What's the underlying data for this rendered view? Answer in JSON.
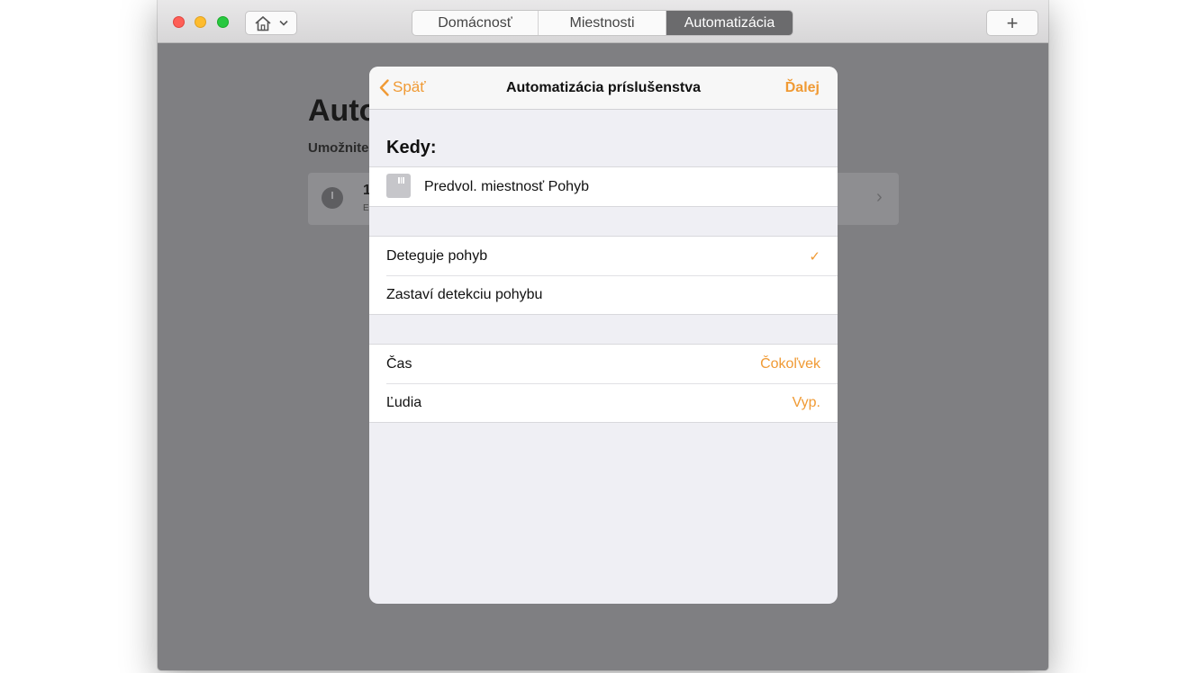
{
  "toolbar": {
    "tabs": [
      {
        "label": "Domácnosť",
        "selected": false
      },
      {
        "label": "Miestnosti",
        "selected": false
      },
      {
        "label": "Automatizácia",
        "selected": true
      }
    ],
    "add_label": "+"
  },
  "background": {
    "title": "Automatizácia",
    "subtitle": "Umožnite",
    "card_number": "1",
    "card_sub": "E"
  },
  "modal": {
    "back_label": "Späť",
    "title": "Automatizácia príslušenstva",
    "next_label": "Ďalej",
    "section_title": "Kedy:",
    "accessory": "Predvol. miestnosť Pohyb",
    "options": [
      {
        "label": "Deteguje pohyb",
        "checked": true,
        "check": "✓"
      },
      {
        "label": "Zastaví detekciu pohybu",
        "checked": false
      }
    ],
    "conditions": [
      {
        "label": "Čas",
        "value": "Čokoľvek"
      },
      {
        "label": "Ľudia",
        "value": "Vyp."
      }
    ]
  },
  "colors": {
    "accent": "#f09a34",
    "selected_tab": "#6b6b6d",
    "dim_background": "#7f7f82"
  }
}
